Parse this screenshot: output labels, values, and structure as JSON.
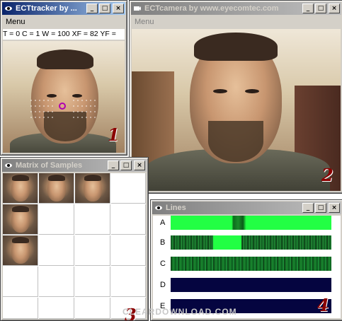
{
  "tracker": {
    "title": "ECTtracker by ...",
    "menu": "Menu",
    "status": "T = 0 C = 1  W = 100 XF = 82 YF ="
  },
  "camera": {
    "title": "ECTcamera by www.eyecomtec.com",
    "menu": "Menu"
  },
  "matrix": {
    "title": "Matrix of Samples"
  },
  "lines": {
    "title": "Lines",
    "rows": [
      {
        "label": "A",
        "color": "#22ff44"
      },
      {
        "label": "B",
        "color": "#1a7a30"
      },
      {
        "label": "C",
        "color": "#136b2a"
      },
      {
        "label": "D",
        "color": "#050540"
      },
      {
        "label": "E",
        "color": "#050540"
      }
    ]
  },
  "badges": [
    "1",
    "2",
    "3",
    "4"
  ],
  "watermark": "CLEARDOWNLOAD.COM",
  "colors": {
    "active_title": "#0a246a",
    "inactive_title": "#808080",
    "badge": "#8b0000"
  }
}
